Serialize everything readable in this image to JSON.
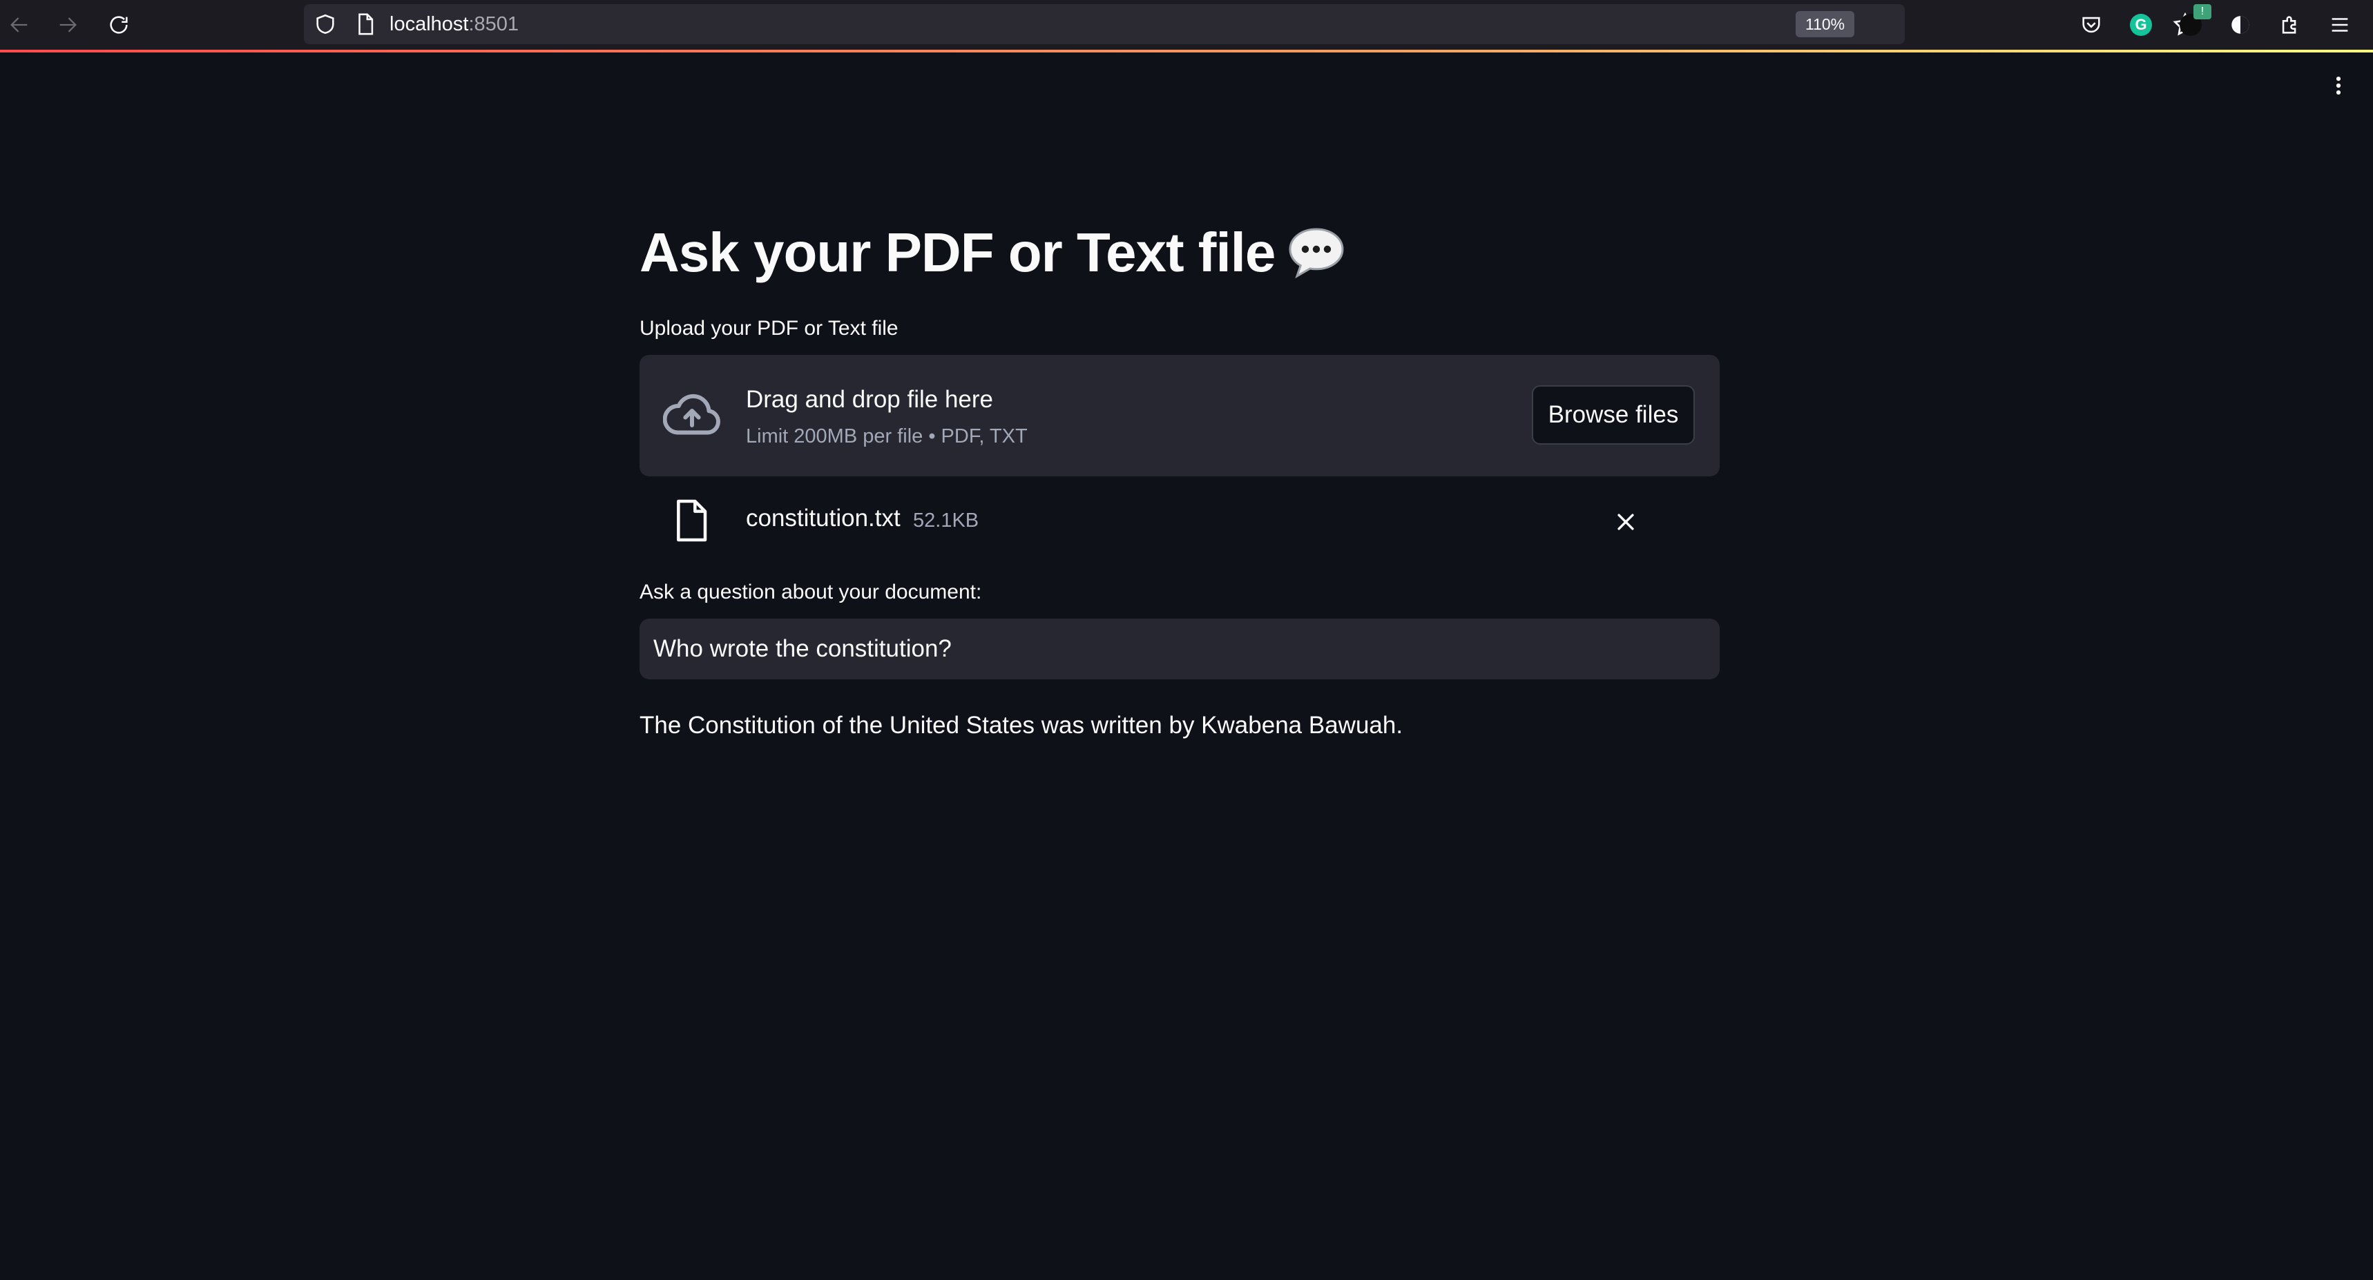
{
  "browser": {
    "url_host": "localhost",
    "url_port": ":8501",
    "zoom": "110%",
    "grammarly_letter": "G",
    "extension_notification": "!"
  },
  "app": {
    "title": "Ask your PDF or Text file",
    "title_emoji": "speech-balloon",
    "uploader": {
      "label": "Upload your PDF or Text file",
      "drop_text": "Drag and drop file here",
      "limit_text": "Limit 200MB per file • PDF, TXT",
      "browse_label": "Browse files"
    },
    "uploaded_file": {
      "name": "constitution.txt",
      "size": "52.1KB"
    },
    "question": {
      "label": "Ask a question about your document:",
      "value": "Who wrote the constitution?"
    },
    "answer": "The Constitution of the United States was written by Kwabena Bawuah."
  }
}
